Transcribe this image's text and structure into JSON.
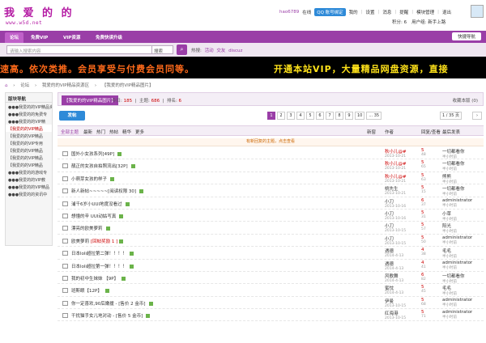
{
  "site": {
    "logo": "我 爱 的 的",
    "url": "www.w5d.net"
  },
  "user": {
    "name": "hao6789",
    "status": "在线",
    "qq": "QQ 账号绑定",
    "links": [
      "我的",
      "设置",
      "消息",
      "提醒",
      "模块管理",
      "退出"
    ],
    "credits": "积分: 6",
    "group": "用户组: 新手上路"
  },
  "nav": {
    "tabs": [
      "论坛",
      "免费VIP",
      "VIP资源",
      "免费快读升级"
    ],
    "quick": "快捷导航"
  },
  "search": {
    "placeholder": "请输入搜索内容",
    "scope": "搜索",
    "hot_label": "热搜:",
    "hot": [
      "活动",
      "交友",
      "discuz"
    ]
  },
  "banner": {
    "left": "速高。依次类推。会员享受与付费会员同等。",
    "right": "开通本站VIP，大量精品网盘资源，直接"
  },
  "breadcrumb": [
    "论坛",
    "我爱的的VIP精品资源区",
    "【我爱的的VIP精品图片】"
  ],
  "sidebar": {
    "title": "版块导航",
    "items": [
      "●●●我爱的的VIP精品资",
      "●●●我爱的的免费专",
      "●●●我爱的的VIP精",
      "【我爱的的VIP精品",
      "【我爱的的VIP精品",
      "【我爱的的VIP专用",
      "【我爱的的VIP精品",
      "【我爱的的VIP精品",
      "【我爱的的VIP精品",
      "●●●我爱的的游戏专",
      "●●●我爱的的VIP教",
      "●●●我爱的的VIP精品",
      "●●●我爱的的资讯中"
    ]
  },
  "forum": {
    "tag": "【我爱的的VIP精品图片】",
    "today_label": "今日:",
    "today": "185",
    "topics_label": "主题:",
    "topics": "686",
    "rank_label": "排名:",
    "rank": "6",
    "fav": "收藏本版 (0)"
  },
  "toolbar": {
    "post": "发帖",
    "pages": [
      "1",
      "2",
      "3",
      "4",
      "5",
      "6",
      "7",
      "8",
      "9",
      "10",
      "... 35"
    ],
    "current_page": "1",
    "page_jump": "/ 35 页",
    "next": "下一页"
  },
  "table_head": {
    "filters": [
      "全部主题",
      "最新",
      "热门",
      "热帖",
      "精华",
      "更多"
    ],
    "new": "新窗",
    "author": "作者",
    "replies": "回复/查看",
    "last": "最后发表"
  },
  "notice": "有新回复的主题，点击查看",
  "threads": [
    {
      "title": "国外小女孩系列[49P]",
      "badge": "",
      "author": "秋小儿@#",
      "author_red": true,
      "date": "2013-10-21",
      "replies": "5",
      "views": "48",
      "last": "一切都看你",
      "last_date": "半小时前"
    },
    {
      "title": "靓正的女孩自拍照流出[32P]",
      "badge": "",
      "author": "秋小儿@#",
      "author_red": true,
      "date": "2013-10-21",
      "replies": "5",
      "views": "65",
      "last": "一切都看你",
      "last_date": "半小时前"
    },
    {
      "title": "小萌芽女孩的样子",
      "badge": "",
      "author": "秋小儿@#",
      "author_red": true,
      "date": "2013-10-21",
      "replies": "5",
      "views": "63",
      "last": "熊熊",
      "last_date": "半小时前"
    },
    {
      "title": "新人新帖~~~~~[阅读权限 30]",
      "badge": "",
      "author": "桃先生",
      "author_red": false,
      "date": "2013-10-21",
      "replies": "5",
      "views": "15",
      "last": "一切都看你",
      "last_date": "半小时前"
    },
    {
      "title": "浦千6岁小UUI地度没看过",
      "badge": "",
      "author": "小刀",
      "author_red": false,
      "date": "2013-10-16",
      "replies": "6",
      "views": "37",
      "last": "administrator",
      "last_date": "半小时前"
    },
    {
      "title": "想懂的辛 UUI动姑写真",
      "badge": "",
      "author": "小刀",
      "author_red": false,
      "date": "2013-10-16",
      "replies": "5",
      "views": "31",
      "last": "小草",
      "last_date": "半小时前"
    },
    {
      "title": "漂亮的欧美萝莉",
      "badge": "",
      "author": "小刀",
      "author_red": false,
      "date": "2013-10-15",
      "replies": "5",
      "views": "57",
      "last": "阳光",
      "last_date": "半小时前"
    },
    {
      "title": "欧美萝莉",
      "badge": "[回帖奖励 1 ]",
      "author": "小刀",
      "author_red": false,
      "date": "2013-10-15",
      "replies": "5",
      "views": "50",
      "last": "administrator",
      "last_date": "半小时前"
    },
    {
      "title": "日本loli超拉第二弹！！！！",
      "badge": "",
      "author": "遇德",
      "author_red": false,
      "date": "2014-4-13",
      "replies": "4",
      "views": "38",
      "last": "毛毛",
      "last_date": "半小时前"
    },
    {
      "title": "日本loli超拉第一弹！！！！",
      "badge": "",
      "author": "遇德",
      "author_red": false,
      "date": "2014-4-13",
      "replies": "4",
      "views": "41",
      "last": "administrator",
      "last_date": "半小时前"
    },
    {
      "title": "我的初中生妹妹 【9P】",
      "badge": "",
      "author": "风歌舞",
      "author_red": false,
      "date": "2014-4-13",
      "replies": "6",
      "views": "82",
      "last": "一切都看你",
      "last_date": "半小时前"
    },
    {
      "title": "班斯眼【12P】",
      "badge": "",
      "author": "蜜忱",
      "author_red": false,
      "date": "2014-4-13",
      "replies": "5",
      "views": "45",
      "last": "毛毛",
      "last_date": "半小时前"
    },
    {
      "title": "你一定喜欢,90后嫩援 - [售价 2 金币]",
      "badge": "",
      "author": "伊曼",
      "author_red": false,
      "date": "2013-10-15",
      "replies": "5",
      "views": "68",
      "last": "administrator",
      "last_date": "半小时前"
    },
    {
      "title": "干扰猫手女儿地对动 - [售价 5 金币]",
      "badge": "",
      "author": "红海港",
      "author_red": false,
      "date": "2013-10-15",
      "replies": "5",
      "views": "71",
      "last": "administrator",
      "last_date": "半小时前"
    }
  ]
}
